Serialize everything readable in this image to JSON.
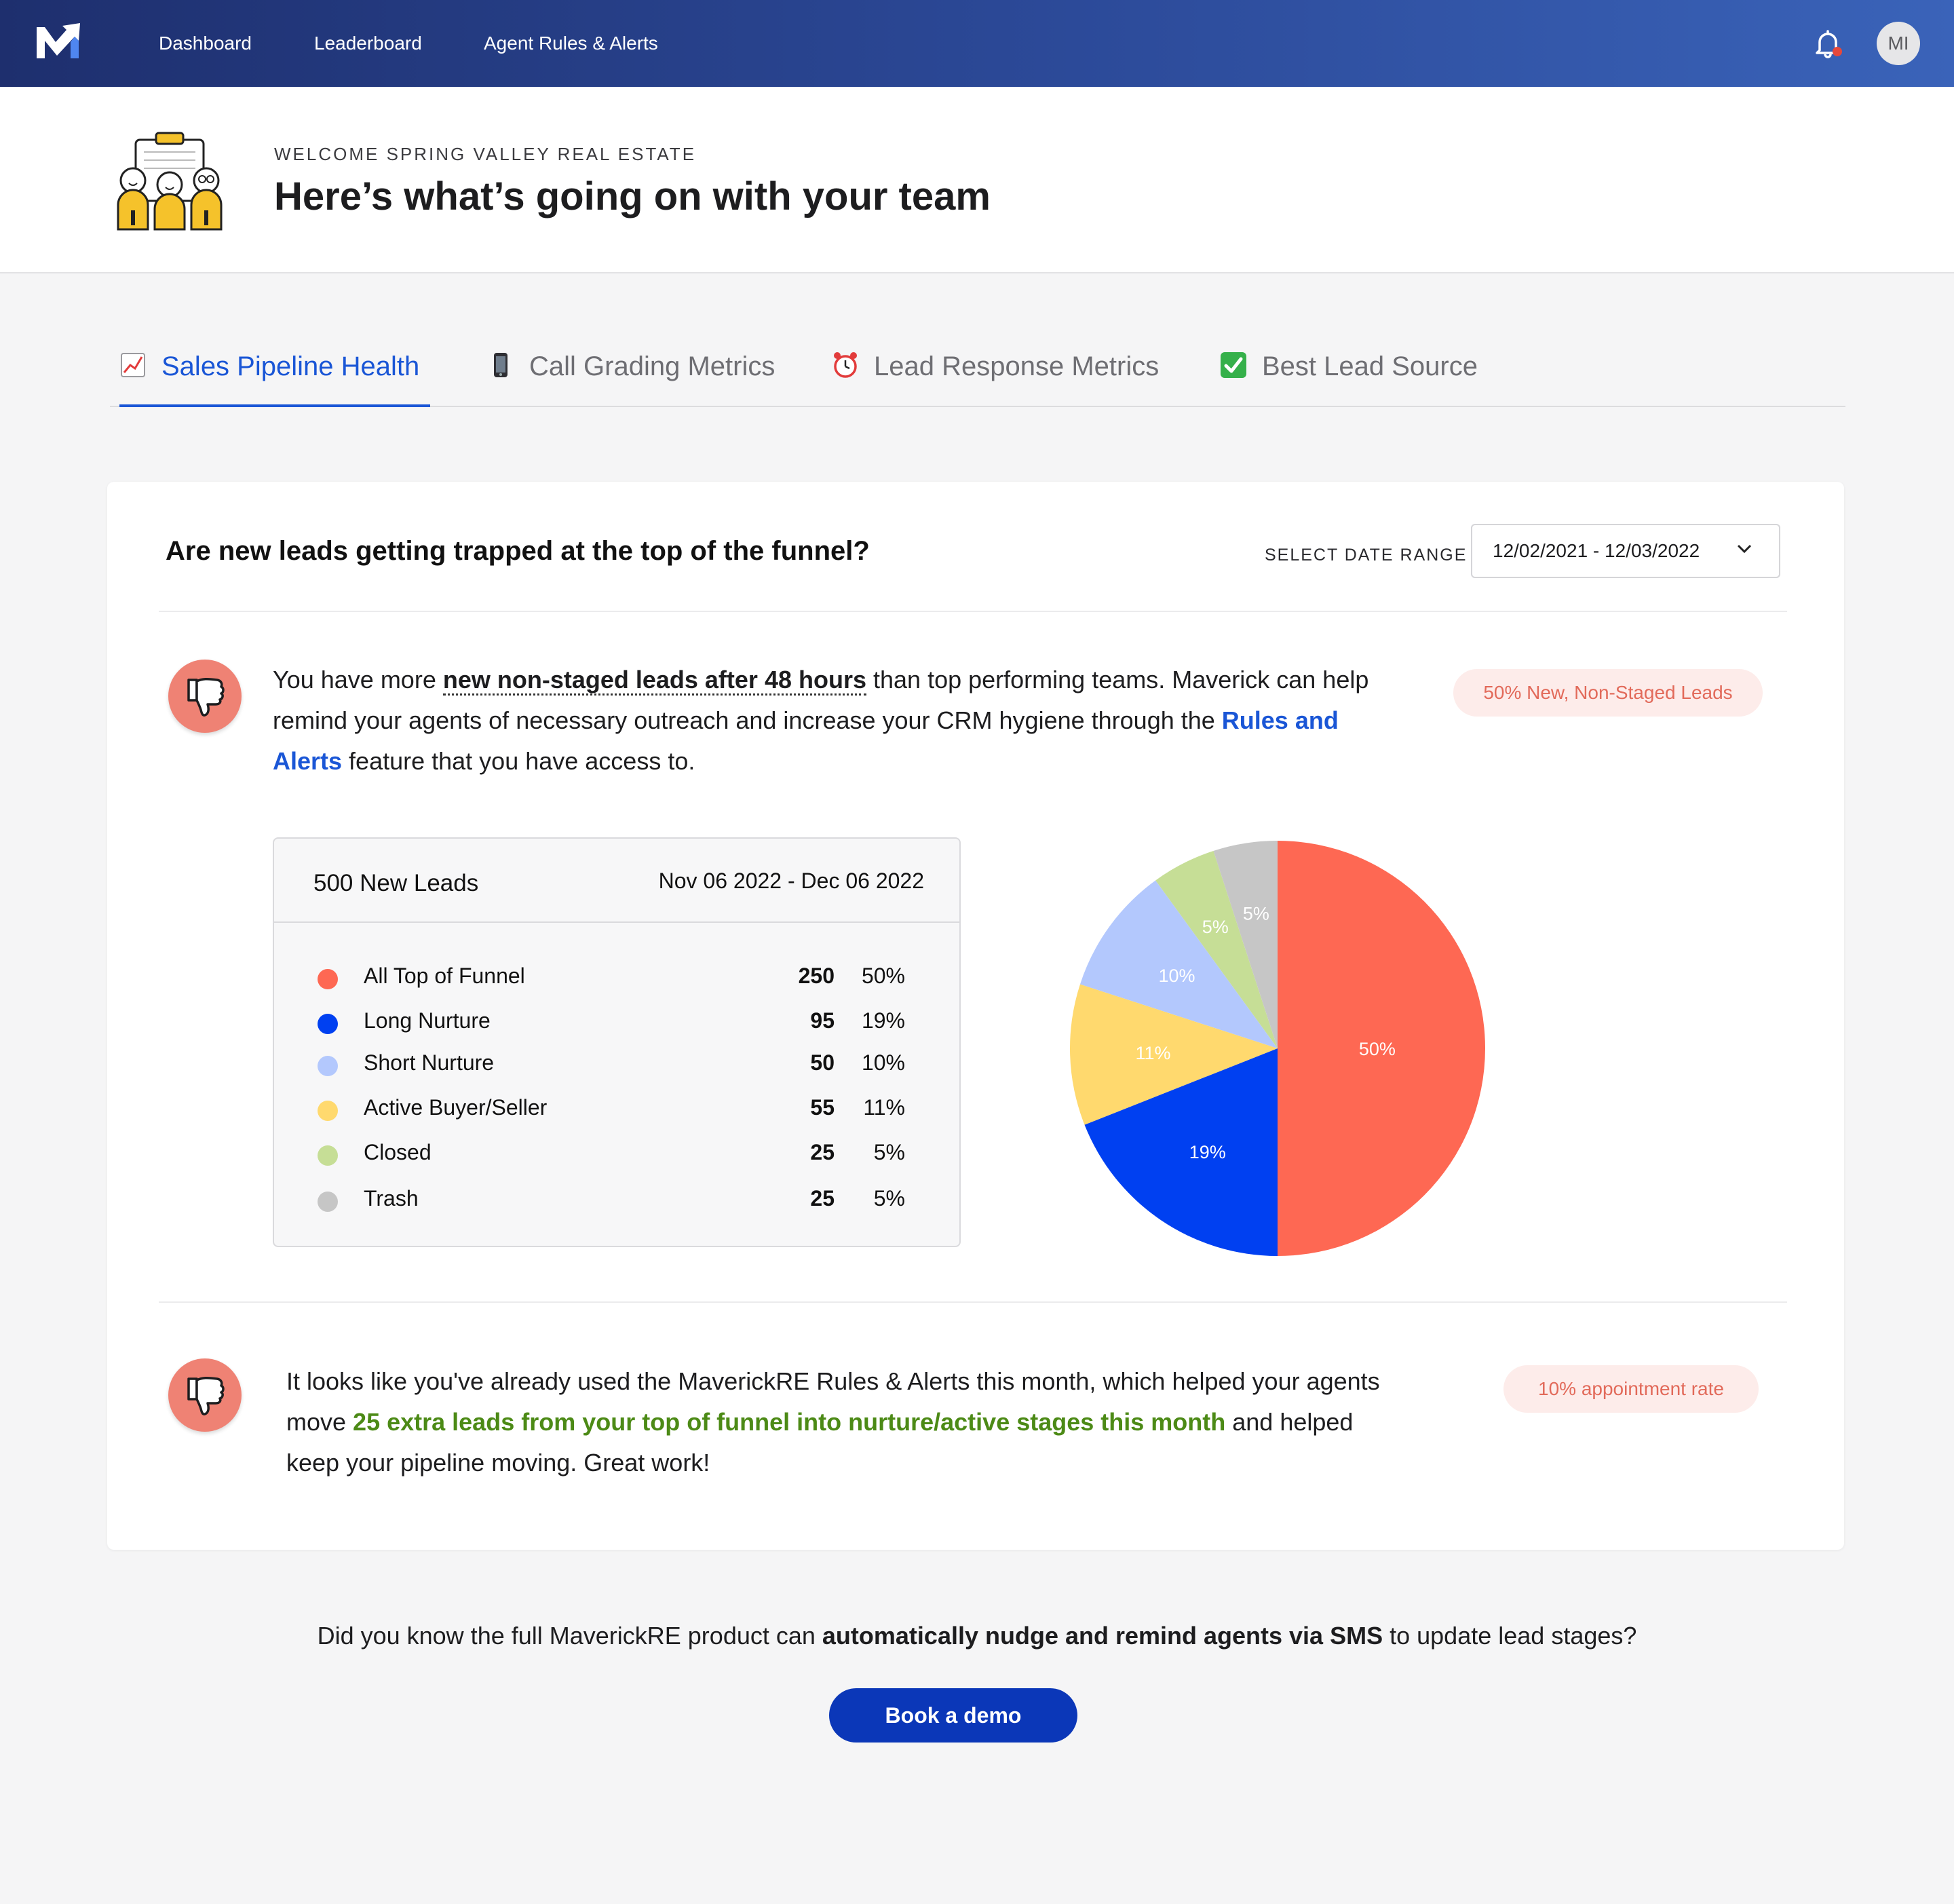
{
  "nav": {
    "links": [
      "Dashboard",
      "Leaderboard",
      "Agent Rules & Alerts"
    ],
    "avatar_initials": "MI",
    "logo_icon": "maverick-m-logo",
    "bell_icon": "bell-icon",
    "notification_color": "#e5483b"
  },
  "header": {
    "kicker": "WELCOME SPRING VALLEY REAL ESTATE",
    "title": "Here’s what’s going on with your team"
  },
  "tabs": [
    {
      "label": "Sales Pipeline Health",
      "icon": "chart-increasing-icon",
      "active": true
    },
    {
      "label": "Call Grading Metrics",
      "icon": "mobile-phone-icon",
      "active": false
    },
    {
      "label": "Lead Response Metrics",
      "icon": "alarm-clock-icon",
      "active": false
    },
    {
      "label": "Best Lead Source",
      "icon": "check-mark-icon",
      "active": false
    }
  ],
  "card": {
    "title": "Are new leads getting trapped at the top of the funnel?",
    "date_range_label": "SELECT DATE RANGE",
    "date_range_value": "12/02/2021 - 12/03/2022",
    "insight1": {
      "t1": "You have more ",
      "t2": "new non-staged leads after 48 hours",
      "t3": " than top performing teams. Maverick can help remind your agents of necessary outreach and increase your CRM hygiene through the ",
      "t4": "Rules and Alerts",
      "t5": " feature that you have access to.",
      "pill": "50% New, Non-Staged Leads"
    },
    "leads_table": {
      "title": "500 New Leads",
      "range": "Nov 06 2022 - Dec 06 2022",
      "rows": [
        {
          "name": "All Top of Funnel",
          "count": "250",
          "pct": "50%",
          "color": "#fe6853"
        },
        {
          "name": "Long Nurture",
          "count": "95",
          "pct": "19%",
          "color": "#0040f1"
        },
        {
          "name": "Short Nurture",
          "count": "50",
          "pct": "10%",
          "color": "#b3c8fd"
        },
        {
          "name": "Active Buyer/Seller",
          "count": "55",
          "pct": "11%",
          "color": "#ffd96e"
        },
        {
          "name": "Closed",
          "count": "25",
          "pct": "5%",
          "color": "#c6de96"
        },
        {
          "name": "Trash",
          "count": "25",
          "pct": "5%",
          "color": "#c6c6c6"
        }
      ]
    },
    "insight2": {
      "t1": "It looks like you've already used the MaverickRE Rules & Alerts this month, which helped your agents move ",
      "t2": "25 extra leads from your top of funnel into nurture/active stages this month",
      "t3": " and helped keep your pipeline moving. Great work!",
      "pill": "10% appointment rate"
    },
    "thumb_icon": "thumbs-down-icon"
  },
  "chart_data": {
    "type": "pie",
    "slices": [
      {
        "label": "All Top of Funnel",
        "value": 50,
        "display": "50%",
        "color": "#fe6853"
      },
      {
        "label": "Long Nurture",
        "value": 19,
        "display": "19%",
        "color": "#0040f1"
      },
      {
        "label": "Active Buyer/Seller",
        "value": 11,
        "display": "11%",
        "color": "#ffd96e"
      },
      {
        "label": "Short Nurture",
        "value": 10,
        "display": "10%",
        "color": "#b3c8fd"
      },
      {
        "label": "Closed",
        "value": 5,
        "display": "5%",
        "color": "#c6de96"
      },
      {
        "label": "Trash",
        "value": 5,
        "display": "5%",
        "color": "#c6c6c6"
      }
    ]
  },
  "promo": {
    "t1": "Did you know the full MaverickRE product can ",
    "t2": "automatically nudge and remind agents via SMS",
    "t3": " to update lead stages?",
    "button": "Book a demo"
  }
}
